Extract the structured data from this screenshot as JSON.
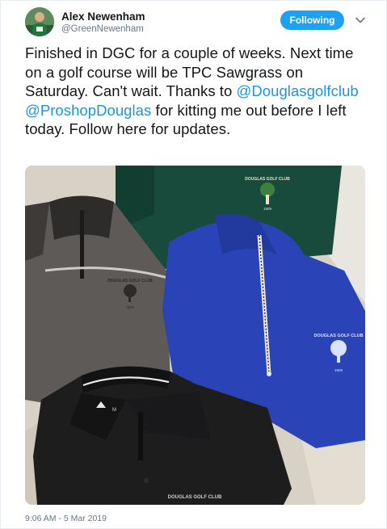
{
  "tweet": {
    "author_name": "Alex Newenham",
    "author_handle": "@GreenNewenham",
    "follow_label": "Following",
    "text": {
      "p1": "Finished in DGC for a couple of weeks. Next time on a golf course will be TPC Sawgrass on Saturday. Can't wait. Thanks to ",
      "mention1": "@Douglasgolfclub",
      "sep": " ",
      "mention2": "@ProshopDouglas",
      "p2": " for kitting me out before I left today. Follow here for updates."
    },
    "timestamp": "9:06 AM - 5 Mar 2019"
  },
  "photo": {
    "logo_text": "DOUGLAS GOLF CLUB",
    "logo_year": "1909",
    "size_tag": "M",
    "alt": "Golf apparel laid out"
  },
  "icons": {
    "avatar": "avatar-image",
    "caret": "chevron-down-icon"
  },
  "colors": {
    "accent": "#1da1f2",
    "link": "#1b95e0",
    "muted": "#657786"
  }
}
